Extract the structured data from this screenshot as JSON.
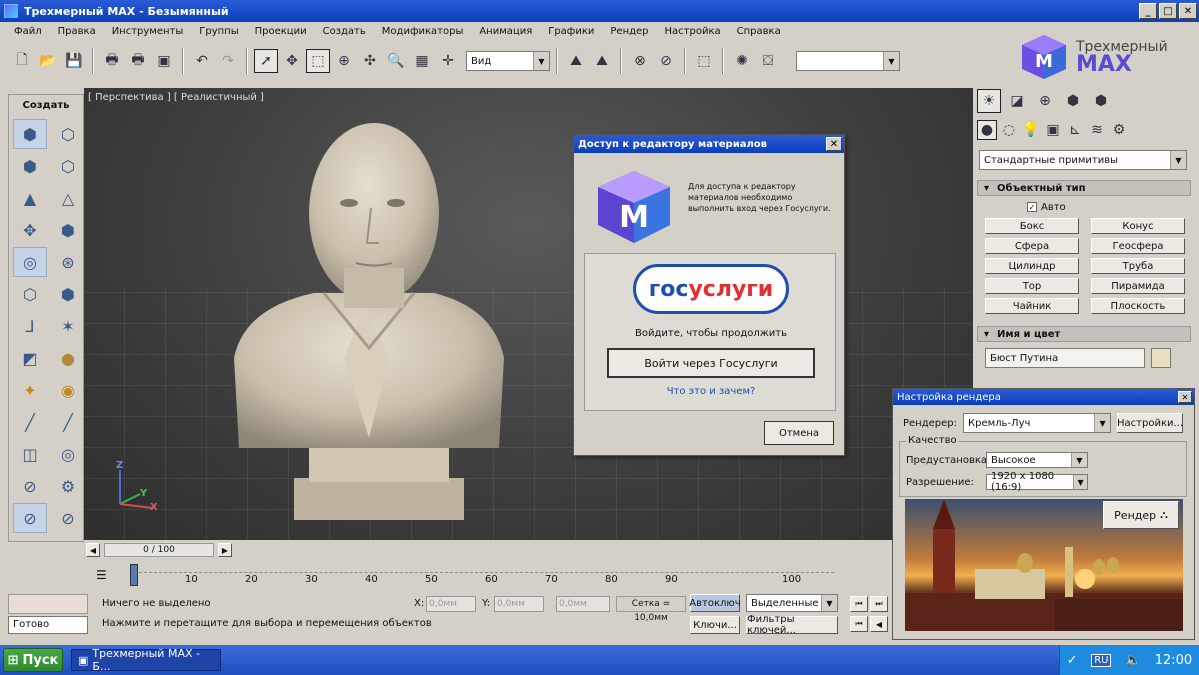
{
  "window": {
    "title": "Трехмерный MAX - Безымянный"
  },
  "menu": [
    "Файл",
    "Правка",
    "Инструменты",
    "Группы",
    "Проекции",
    "Создать",
    "Модификаторы",
    "Анимация",
    "Графики",
    "Рендер",
    "Настройка",
    "Справка"
  ],
  "toolbar": {
    "view_combo": "Вид",
    "selection_combo": ""
  },
  "logo": {
    "line1": "Трехмерный",
    "line2": "MAX"
  },
  "create_panel": {
    "title": "Создать"
  },
  "viewport": {
    "label": "[ Перспектива ] [ Реалистичный ]",
    "axis_x": "X",
    "axis_y": "Y",
    "axis_z": "Z"
  },
  "dialog": {
    "title": "Доступ к редактору материалов",
    "message": "Для доступа к редактору материалов необходимо выполнить вход через Госуслуги.",
    "brand_gos": "гос",
    "brand_uslugi": "услуги",
    "prompt": "Войдите, чтобы продолжить",
    "login_button": "Войти через Госуслуги",
    "help_link": "Что это и зачем?",
    "cancel_button": "Отмена"
  },
  "command_panel": {
    "category_combo": "Стандартные примитивы",
    "object_type_header": "Объектный тип",
    "auto_label": "Авто",
    "auto_checked": true,
    "buttons": [
      "Бокс",
      "Конус",
      "Сфера",
      "Геосфера",
      "Цилиндр",
      "Труба",
      "Тор",
      "Пирамида",
      "Чайник",
      "Плоскость"
    ],
    "name_color_header": "Имя и цвет",
    "object_name": "Бюст Путина",
    "object_color": "#e8e0c0"
  },
  "render_settings": {
    "title": "Настройка рендера",
    "renderer_label": "Рендерер:",
    "renderer_value": "Кремль-Луч",
    "settings_button": "Настройки...",
    "quality_group": "Качество",
    "preset_label": "Предустановка:",
    "preset_value": "Высокое",
    "resolution_label": "Разрешение:",
    "resolution_value": "1920 x 1080 (16:9)",
    "render_button": "Рендер"
  },
  "timeline": {
    "frame": "0 / 100",
    "ticks": [
      "10",
      "20",
      "30",
      "40",
      "50",
      "60",
      "70",
      "80",
      "90",
      "100"
    ]
  },
  "status": {
    "ready": "Готово",
    "nothing_selected": "Ничего не выделено",
    "hint": "Нажмите и перетащите для выбора и перемещения объектов",
    "x_label": "X:",
    "x_value": "0,0мм",
    "y_label": "Y:",
    "y_value": "0,0мм",
    "z_value": "0,0мм",
    "grid": "Сетка = 10,0мм",
    "autokey": "Автоключ",
    "selected_combo": "Выделенные",
    "keys_button": "Ключи...",
    "key_filters_button": "Фильтры ключей..."
  },
  "taskbar": {
    "start": "Пуск",
    "task": "Трехмерный MAX - Б...",
    "lang": "RU",
    "clock": "12:00"
  },
  "colors": {
    "title_blue": "#0b3fb8",
    "accent_purple": "#5a4bd6",
    "gosuslugi_blue": "#1e4fb0",
    "gosuslugi_red": "#e03030"
  }
}
